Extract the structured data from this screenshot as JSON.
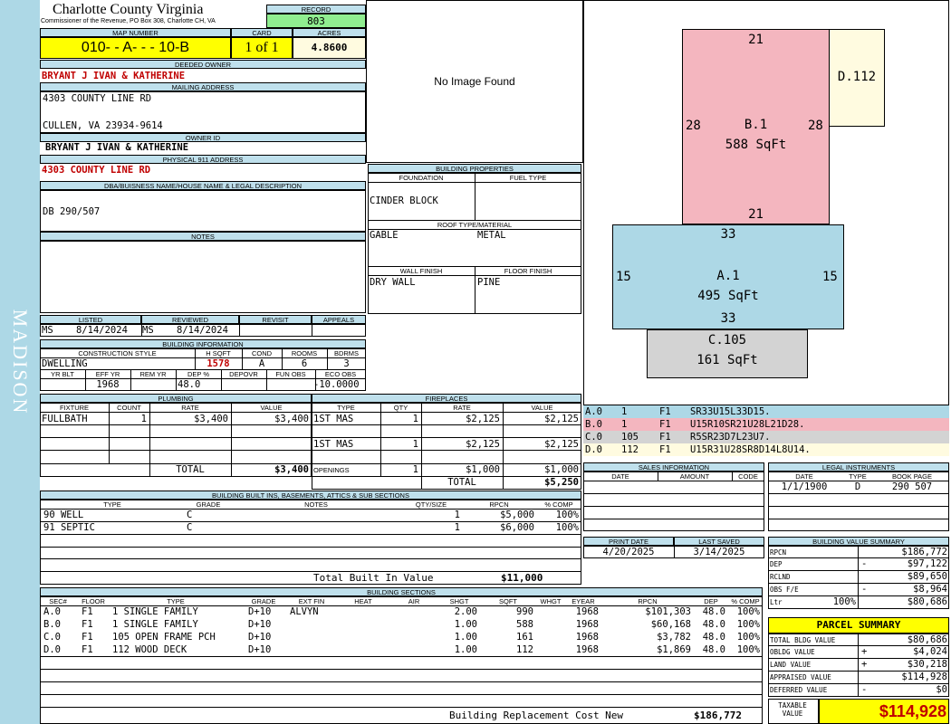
{
  "side_label": "MADISON",
  "header": {
    "title": "Charlotte County Virginia",
    "subtitle": "Commissioner of the Revenue, PO Box 308, Charlotte CH, VA",
    "record_label": "RECORD",
    "record": "803"
  },
  "map": {
    "label": "MAP NUMBER",
    "value": "010- - A- - - 10-B",
    "card_label": "CARD",
    "card": "1 of 1",
    "acres_label": "ACRES",
    "acres": "4.8600"
  },
  "owner": {
    "deeded_label": "DEEDED OWNER",
    "deeded": "BRYANT J IVAN & KATHERINE",
    "mailing_label": "MAILING ADDRESS",
    "mailing1": "4303 COUNTY LINE RD",
    "mailing2": "CULLEN, VA 23934-9614",
    "id_label": "OWNER ID",
    "owner_id": "BRYANT J IVAN & KATHERINE",
    "phys_label": "PHYSICAL 911 ADDRESS",
    "phys": "4303 COUNTY LINE RD"
  },
  "legal": {
    "label": "DBA/BUISNESS NAME/HOUSE NAME & LEGAL DESCRIPTION",
    "value": "DB 290/507",
    "notes_label": "NOTES"
  },
  "image": {
    "text": "No Image Found"
  },
  "building_props": {
    "label": "BUILDING PROPERTIES",
    "foundation_label": "FOUNDATION",
    "foundation": "CINDER BLOCK",
    "fuel_label": "FUEL TYPE",
    "fuel": "",
    "roof_label": "ROOF TYPE/MATERIAL",
    "roof_type": "GABLE",
    "roof_material": "METAL",
    "wall_label": "WALL FINISH",
    "wall": "DRY WALL",
    "floor_label": "FLOOR FINISH",
    "floor": "PINE"
  },
  "status": {
    "listed_label": "LISTED",
    "listed_by": "MS",
    "listed": "8/14/2024",
    "reviewed_label": "REVIEWED",
    "reviewed_by": "MS",
    "reviewed": "8/14/2024",
    "revisit_label": "REVISIT",
    "appeals_label": "APPEALS"
  },
  "building_info": {
    "label": "BUILDING INFORMATION",
    "style_label": "CONSTRUCTION STYLE",
    "style": "DWELLING",
    "hsqft_label": "H SQFT",
    "hsqft": "1578",
    "cond_label": "COND",
    "cond": "A",
    "rooms_label": "ROOMS",
    "rooms": "6",
    "bdrms_label": "BDRMS",
    "bdrms": "3",
    "yrblt_label": "YR BLT",
    "effyr_label": "EFF YR",
    "effyr": "1968",
    "remyr_label": "REM YR",
    "dep_label": "DEP %",
    "dep": "48.0",
    "depovr_label": "DEPOVR",
    "funobs_label": "FUN OBS",
    "ecoobs_label": "ECO OBS",
    "ecoobs": "-10.0000"
  },
  "plumbing": {
    "label": "PLUMBING",
    "cols": [
      "FIXTURE",
      "COUNT",
      "RATE",
      "VALUE"
    ],
    "rows": [
      [
        "FULLBATH",
        "1",
        "$3,400",
        "$3,400"
      ]
    ],
    "total_label": "TOTAL",
    "total": "$3,400"
  },
  "fireplaces": {
    "label": "FIREPLACES",
    "cols": [
      "TYPE",
      "QTY",
      "RATE",
      "VALUE"
    ],
    "rows": [
      [
        "1ST MAS",
        "1",
        "$2,125",
        "$2,125"
      ],
      [
        "1ST MAS",
        "1",
        "$2,125",
        "$2,125"
      ],
      [
        "OPENINGS",
        "1",
        "$1,000",
        "$1,000"
      ]
    ],
    "total_label": "TOTAL",
    "total": "$5,250"
  },
  "builtins": {
    "label": "BUILDING BUILT INS, BASEMENTS, ATTICS & SUB SECTIONS",
    "cols": [
      "TYPE",
      "GRADE",
      "NOTES",
      "QTY/SIZE",
      "RPCN",
      "% COMP"
    ],
    "rows": [
      [
        "90 WELL",
        "C",
        "",
        "1",
        "$5,000",
        "100%"
      ],
      [
        "91 SEPTIC",
        "C",
        "",
        "1",
        "$6,000",
        "100%"
      ]
    ],
    "total_label": "Total Built In Value",
    "total": "$11,000"
  },
  "sections": {
    "label": "BUILDING SECTIONS",
    "cols": [
      "SEC#",
      "FLOOR",
      "TYPE",
      "GRADE",
      "EXT FIN",
      "HEAT",
      "AIR",
      "SHGT",
      "SQFT",
      "WHGT",
      "EYEAR",
      "RPCN",
      "DEP",
      "% COMP"
    ],
    "rows": [
      [
        "A.0",
        "F1",
        "1 SINGLE FAMILY",
        "D+10",
        "ALVYN",
        "",
        "",
        "2.00",
        "990",
        "",
        "1968",
        "$101,303",
        "48.0",
        "100%"
      ],
      [
        "B.0",
        "F1",
        "1 SINGLE FAMILY",
        "D+10",
        "",
        "",
        "",
        "1.00",
        "588",
        "",
        "1968",
        "$60,168",
        "48.0",
        "100%"
      ],
      [
        "C.0",
        "F1",
        "105 OPEN FRAME PCH",
        "D+10",
        "",
        "",
        "",
        "1.00",
        "161",
        "",
        "1968",
        "$3,782",
        "48.0",
        "100%"
      ],
      [
        "D.0",
        "F1",
        "112 WOOD DECK",
        "D+10",
        "",
        "",
        "",
        "1.00",
        "112",
        "",
        "1968",
        "$1,869",
        "48.0",
        "100%"
      ]
    ],
    "replacement_label": "Building Replacement Cost New",
    "replacement": "$186,772"
  },
  "sketch": {
    "areas": [
      {
        "id": "B.1",
        "sqft": "588 SqFt",
        "top": "21",
        "bottom": "21",
        "left": "28",
        "right": "28",
        "color": "#f4b6bf"
      },
      {
        "id": "D.112",
        "color": "#fffbe0"
      },
      {
        "id": "A.1",
        "sqft": "495 SqFt",
        "top": "33",
        "bottom": "33",
        "left": "15",
        "right": "15",
        "color": "#add8e6"
      },
      {
        "id": "C.105",
        "sqft": "161 SqFt",
        "color": "#d3d3d3"
      }
    ],
    "lines": [
      {
        "sec": "A.0",
        "a": "1",
        "f": "F1",
        "path": "SR33U15L33D15.",
        "color": "#add8e6"
      },
      {
        "sec": "B.0",
        "a": "1",
        "f": "F1",
        "path": "U15R10SR21U28L21D28.",
        "color": "#f4b6bf"
      },
      {
        "sec": "C.0",
        "a": "105",
        "f": "F1",
        "path": "R5SR23D7L23U7.",
        "color": "#d3d3d3"
      },
      {
        "sec": "D.0",
        "a": "112",
        "f": "F1",
        "path": "U15R31U28SR8D14L8U14.",
        "color": "#fffbe0"
      }
    ]
  },
  "sales": {
    "label": "SALES INFORMATION",
    "cols": [
      "DATE",
      "AMOUNT",
      "CODE"
    ]
  },
  "legal_instr": {
    "label": "LEGAL INSTRUMENTS",
    "cols": [
      "DATE",
      "TYPE",
      "BOOK PAGE"
    ],
    "rows": [
      [
        "1/1/1900",
        "D",
        "290 507"
      ]
    ]
  },
  "dates": {
    "print_label": "PRINT DATE",
    "print": "4/20/2025",
    "saved_label": "LAST SAVED",
    "saved": "3/14/2025"
  },
  "value_summary": {
    "label": "BUILDING VALUE SUMMARY",
    "rows": [
      [
        "RPCN",
        "",
        "$186,772"
      ],
      [
        "DEP",
        "-",
        "$97,122"
      ],
      [
        "RCLND",
        "",
        "$89,650"
      ],
      [
        "OBS F/E",
        "-",
        "$8,964"
      ],
      [
        "Ltr",
        "100%",
        "$80,686"
      ]
    ]
  },
  "parcel": {
    "label": "PARCEL SUMMARY",
    "rows": [
      [
        "TOTAL BLDG VALUE",
        "",
        "$80,686"
      ],
      [
        "OBLDG VALUE",
        "+",
        "$4,024"
      ],
      [
        "LAND VALUE",
        "+",
        "$30,218"
      ],
      [
        "APPRAISED VALUE",
        "",
        "$114,928"
      ],
      [
        "DEFERRED VALUE",
        "-",
        "$0"
      ]
    ],
    "taxable_label": "TAXABLE VALUE",
    "taxable": "$114,928"
  }
}
